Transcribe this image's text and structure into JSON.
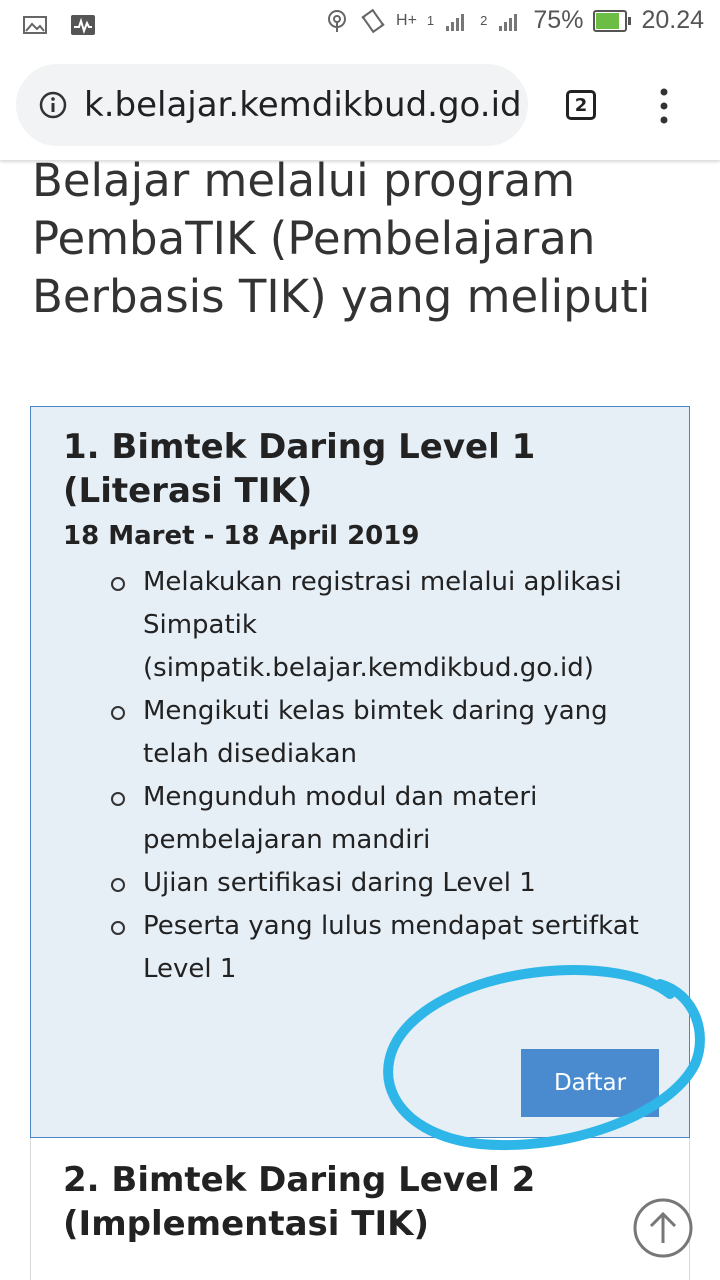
{
  "status_bar": {
    "battery_percent": "75%",
    "time": "20.24",
    "battery_level": 0.75,
    "sim1_label": "1",
    "sim2_label": "2",
    "network_label": "H+"
  },
  "browser": {
    "url": "k.belajar.kemdikbud.go.id",
    "tab_count": "2"
  },
  "page": {
    "heading": "Belajar melalui program PembaTIK (Pembelajaran Berbasis TIK) yang meliputi",
    "level1": {
      "title": "1. Bimtek Daring Level 1 (Literasi TIK)",
      "date": "18 Maret - 18 April 2019",
      "items": [
        "Melakukan registrasi melalui aplikasi Simpatik (simpatik.belajar.kemdikbud.go.id)",
        "Mengikuti kelas bimtek daring yang telah disediakan",
        "Mengunduh modul dan materi pembelajaran mandiri",
        "Ujian sertifikasi daring Level 1",
        "Peserta yang lulus mendapat sertifkat Level 1"
      ],
      "button_label": "Daftar"
    },
    "level2": {
      "title": "2. Bimtek Daring Level 2 (Implementasi TIK)"
    }
  },
  "colors": {
    "card_bg": "#e6eef6",
    "card_border": "#4a86c5",
    "button_bg": "#4a8bd0",
    "highlight": "#2fb6e8",
    "battery": "#6cbd45"
  },
  "icons": {
    "status_left": [
      "image-icon",
      "activity-icon"
    ],
    "status_right": [
      "hotspot-icon",
      "vibrate-icon",
      "signal-icon",
      "signal-icon",
      "battery-icon"
    ],
    "url_bar": [
      "info-icon",
      "tabs-icon",
      "more-vert-icon"
    ],
    "page": [
      "scroll-top-icon"
    ]
  }
}
